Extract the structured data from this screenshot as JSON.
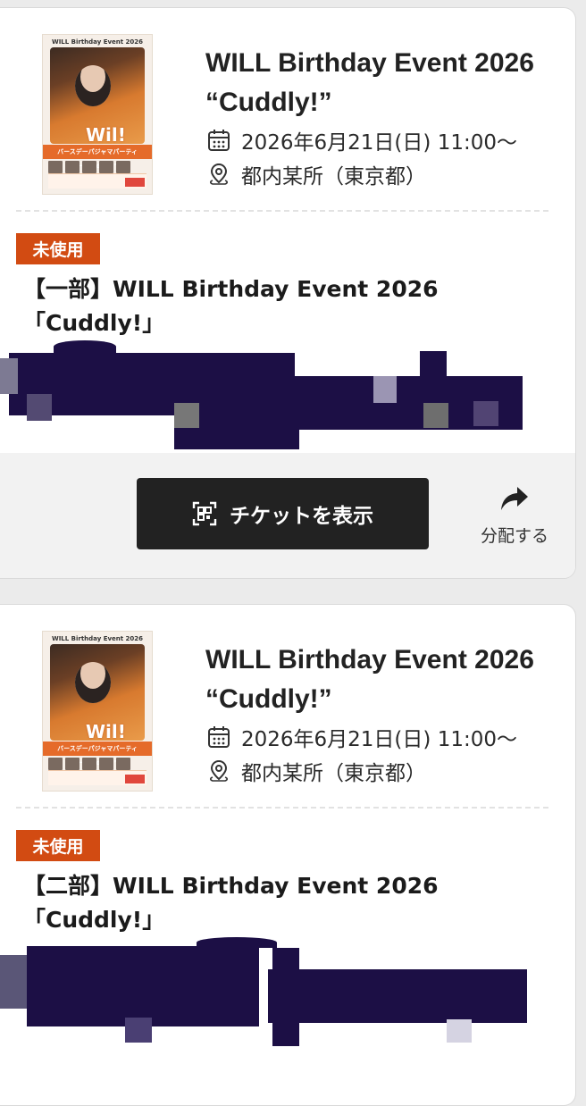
{
  "tickets": [
    {
      "event": {
        "title": "WILL Birthday Event 2026 “Cuddly!”",
        "date": "2026年6月21日(日) 11:00〜",
        "place": "都内某所（東京都）"
      },
      "poster": {
        "header": "WILL Birthday Event 2026",
        "logo": "Wil!",
        "band": "バースデーパジャマパーティー“Cuddly!”"
      },
      "status": "未使用",
      "ticket_name": "【一部】WILL Birthday Event 2026\n「Cuddly!」",
      "show_ticket_label": "チケットを表示",
      "share_label": "分配する"
    },
    {
      "event": {
        "title": "WILL Birthday Event 2026 “Cuddly!”",
        "date": "2026年6月21日(日) 11:00〜",
        "place": "都内某所（東京都）"
      },
      "poster": {
        "header": "WILL Birthday Event 2026",
        "logo": "Wil!",
        "band": "バースデーパジャマパーティー“Cuddly!”"
      },
      "status": "未使用",
      "ticket_name": "【二部】WILL Birthday Event 2026\n「Cuddly!」"
    }
  ],
  "icons": {
    "date": "calendar-icon",
    "place": "location-pin-icon",
    "show_ticket": "qr-code-icon",
    "share": "share-arrow-icon"
  },
  "colors": {
    "status_badge": "#d24b12",
    "button": "#222222",
    "redaction": "#1c0f45"
  }
}
